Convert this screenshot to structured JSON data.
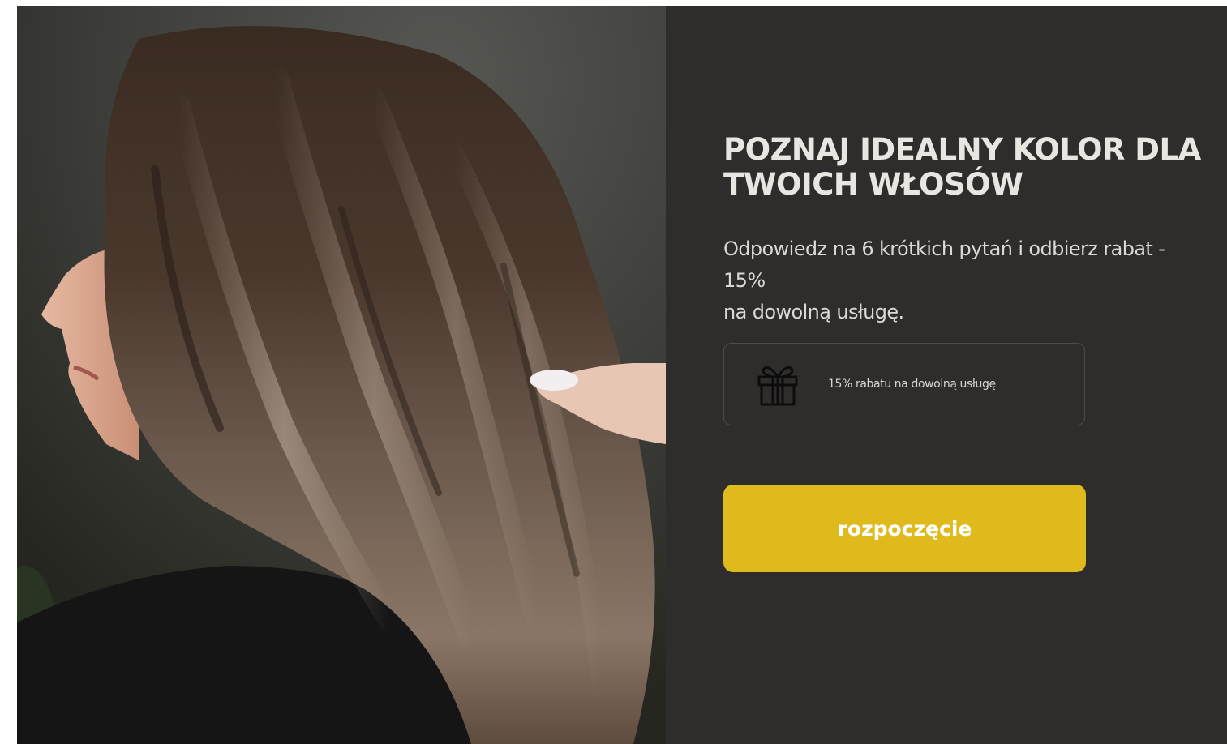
{
  "hero": {
    "headline": "POZNAJ  IDEALNY KOLOR DLA TWOICH WŁOSÓW",
    "subtext_line1": "Odpowiedz na 6 krótkich pytań i  odbierz rabat -",
    "subtext_line2": "15%",
    "subtext_line3": "na dowolną usługę.",
    "promo_text": "15% rabatu na dowolną usługę",
    "promo_icon": "gift-icon",
    "start_label": "rozpoczęcie"
  },
  "colors": {
    "panel_background": "#2f2d2c",
    "accent_button": "#e0b91c",
    "headline_text": "#e9e6e2"
  }
}
